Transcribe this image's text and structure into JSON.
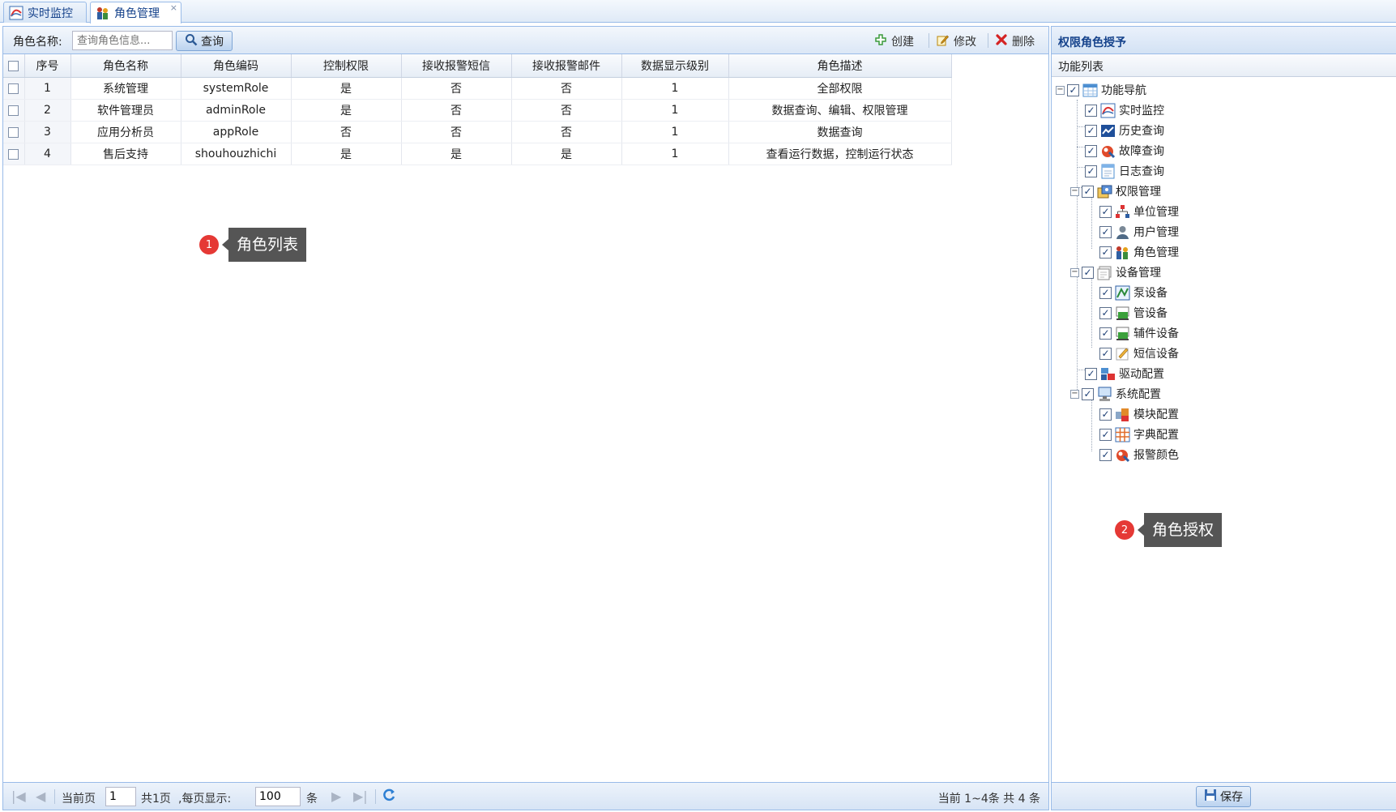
{
  "tabs": [
    {
      "label": "实时监控",
      "active": false
    },
    {
      "label": "角色管理",
      "active": true,
      "close": "×"
    }
  ],
  "toolbar": {
    "search_label": "角色名称:",
    "search_placeholder": "查询角色信息...",
    "query_label": "查询",
    "create_label": "创建",
    "edit_label": "修改",
    "delete_label": "删除"
  },
  "grid": {
    "columns": [
      "序号",
      "角色名称",
      "角色编码",
      "控制权限",
      "接收报警短信",
      "接收报警邮件",
      "数据显示级别",
      "角色描述"
    ],
    "rows": [
      [
        "1",
        "系统管理",
        "systemRole",
        "是",
        "否",
        "否",
        "1",
        "全部权限"
      ],
      [
        "2",
        "软件管理员",
        "adminRole",
        "是",
        "否",
        "否",
        "1",
        "数据查询、编辑、权限管理"
      ],
      [
        "3",
        "应用分析员",
        "appRole",
        "否",
        "否",
        "否",
        "1",
        "数据查询"
      ],
      [
        "4",
        "售后支持",
        "shouhouzhichi",
        "是",
        "是",
        "是",
        "1",
        "查看运行数据，控制运行状态"
      ]
    ]
  },
  "pager": {
    "current_page_label": "当前页",
    "current_page": "1",
    "total_pages": "共1页",
    "per_page_label": ",每页显示:",
    "per_page": "100",
    "unit": "条",
    "summary": "当前 1~4条 共 4 条"
  },
  "annotations": [
    {
      "num": "1",
      "text": "角色列表"
    },
    {
      "num": "2",
      "text": "角色授权"
    }
  ],
  "right_panel": {
    "title": "权限角色授予",
    "subheader": "功能列表",
    "tree": [
      {
        "label": "功能导航",
        "icon": "grid-icon",
        "checked": true
      },
      {
        "label": "实时监控",
        "icon": "monitor-icon",
        "checked": true
      },
      {
        "label": "历史查询",
        "icon": "chart-icon",
        "checked": true
      },
      {
        "label": "故障查询",
        "icon": "fault-icon",
        "checked": true
      },
      {
        "label": "日志查询",
        "icon": "log-icon",
        "checked": true
      },
      {
        "label": "权限管理",
        "icon": "permission-icon",
        "checked": true
      },
      {
        "label": "单位管理",
        "icon": "org-icon",
        "checked": true
      },
      {
        "label": "用户管理",
        "icon": "user-icon",
        "checked": true
      },
      {
        "label": "角色管理",
        "icon": "role-icon",
        "checked": true
      },
      {
        "label": "设备管理",
        "icon": "device-icon",
        "checked": true
      },
      {
        "label": "泵设备",
        "icon": "pump-icon",
        "checked": true
      },
      {
        "label": "管设备",
        "icon": "pipe-icon",
        "checked": true
      },
      {
        "label": "辅件设备",
        "icon": "accessory-icon",
        "checked": true
      },
      {
        "label": "短信设备",
        "icon": "sms-icon",
        "checked": true
      },
      {
        "label": "驱动配置",
        "icon": "driver-icon",
        "checked": true
      },
      {
        "label": "系统配置",
        "icon": "system-icon",
        "checked": true
      },
      {
        "label": "模块配置",
        "icon": "module-icon",
        "checked": true
      },
      {
        "label": "字典配置",
        "icon": "dictionary-icon",
        "checked": true
      },
      {
        "label": "报警颜色",
        "icon": "alarm-color-icon",
        "checked": true
      }
    ],
    "save_label": "保存"
  },
  "colors": {
    "border": "#99bbe8",
    "title_text": "#15428b",
    "badge_red": "#e53935",
    "callout_bg": "#555555"
  }
}
